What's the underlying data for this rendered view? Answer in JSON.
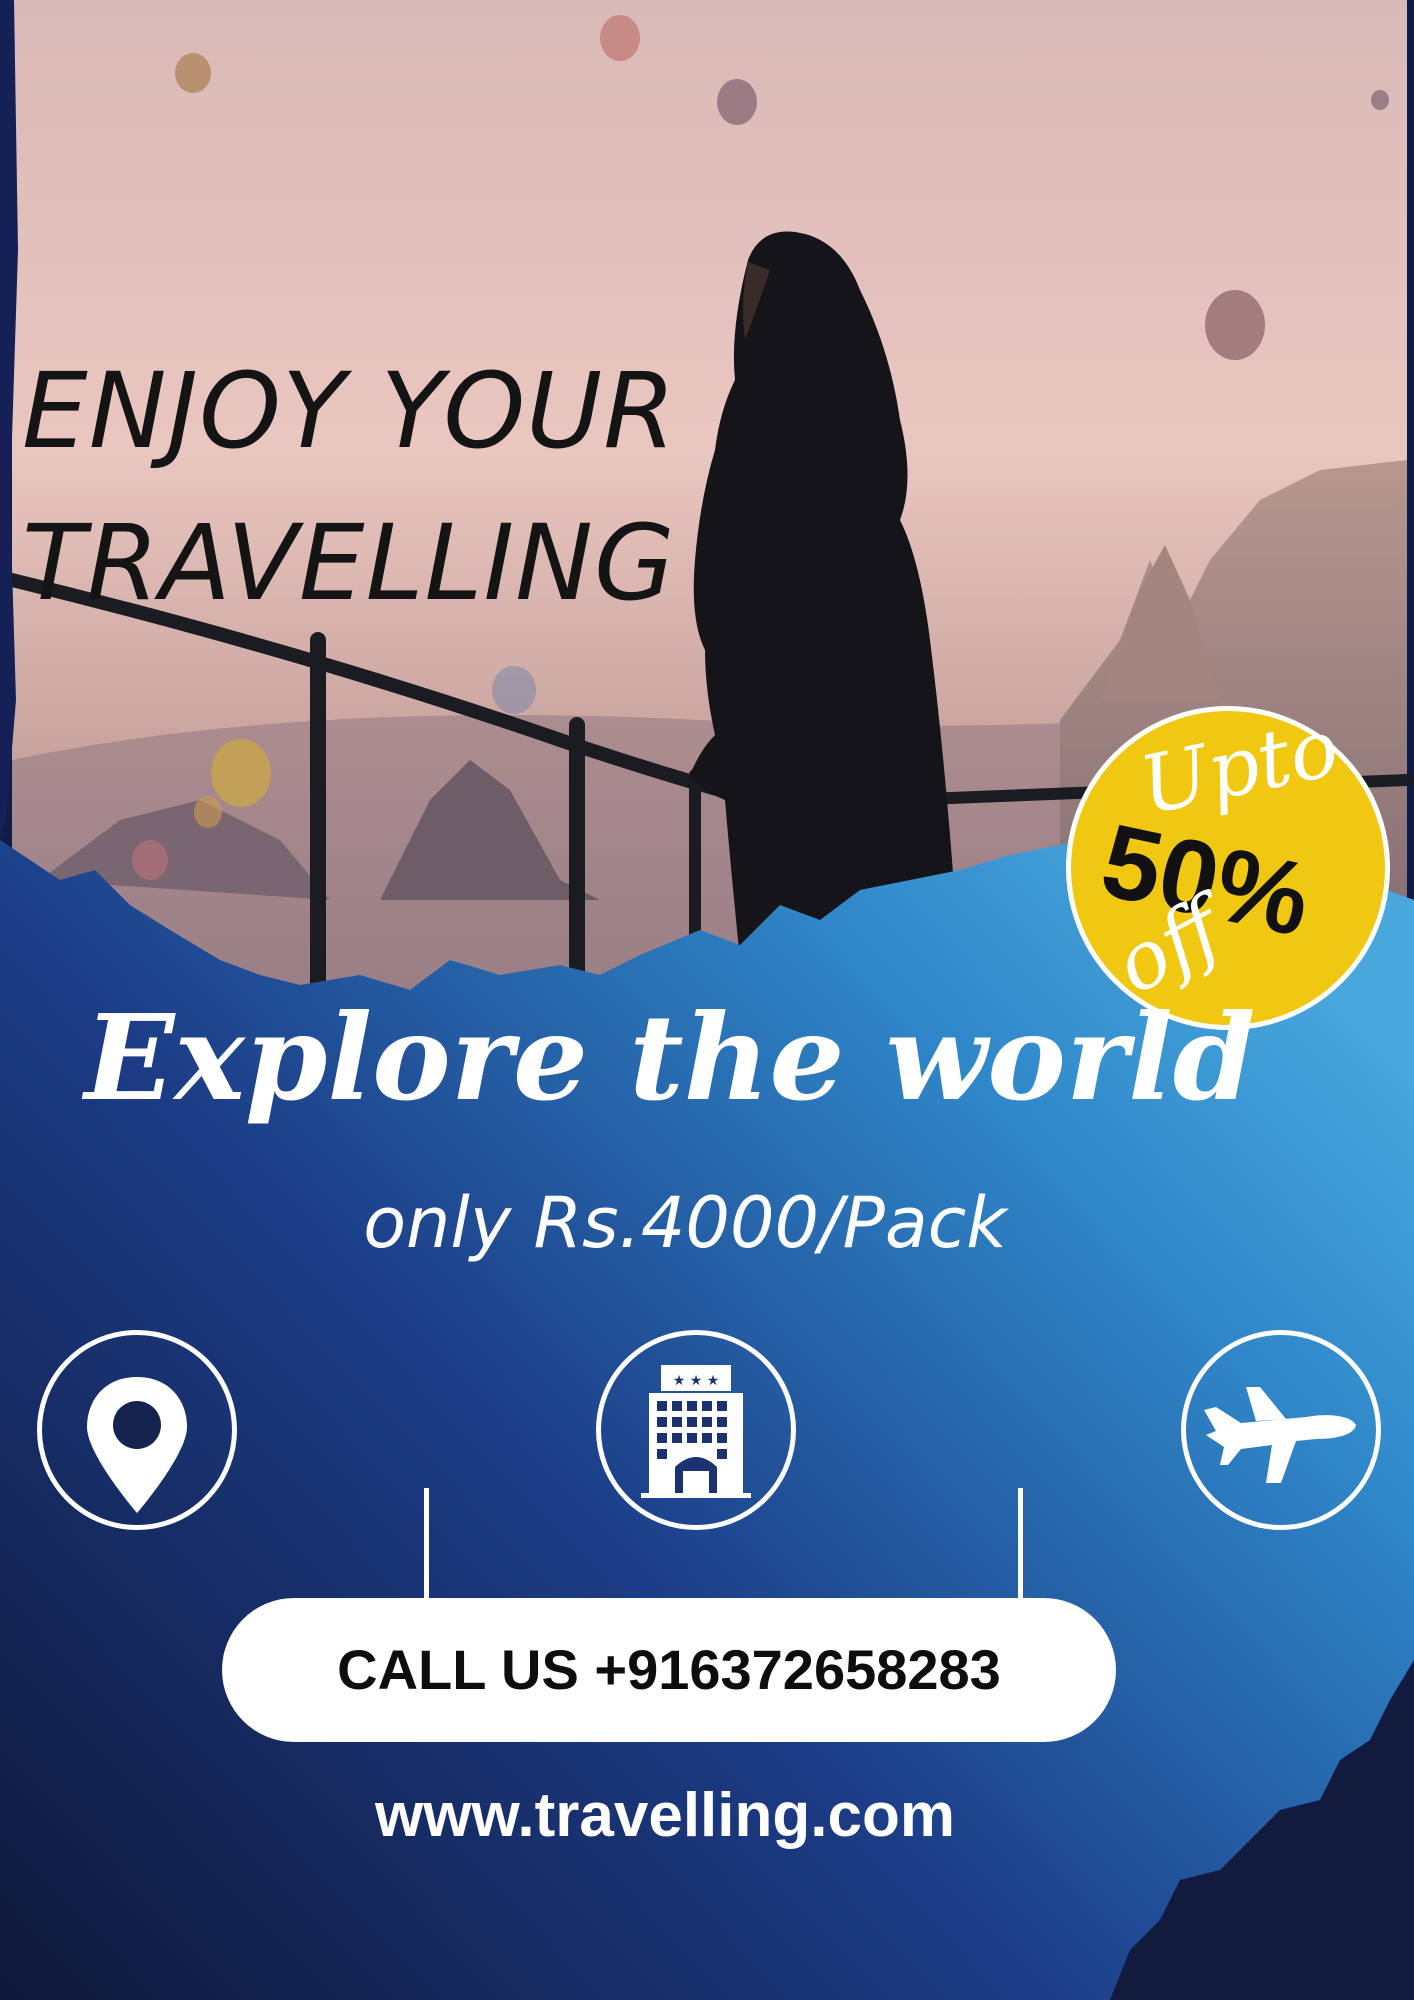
{
  "headline": {
    "line1": "ENJOY YOUR",
    "line2": "TRAVELLING"
  },
  "badge": {
    "upto": "Upto",
    "percent": "50%",
    "off": "off"
  },
  "tagline": "Explore the world",
  "price": "only Rs.4000/Pack",
  "icons": [
    "location-pin-icon",
    "hotel-building-icon",
    "airplane-icon"
  ],
  "cta": {
    "call_label": "CALL US +916372658283"
  },
  "website": "www.travelling.com",
  "colors": {
    "navy": "#111c46",
    "blue": "#3fa2dc",
    "badge_yellow": "#f1c811",
    "white": "#ffffff",
    "text_dark": "#141414"
  }
}
